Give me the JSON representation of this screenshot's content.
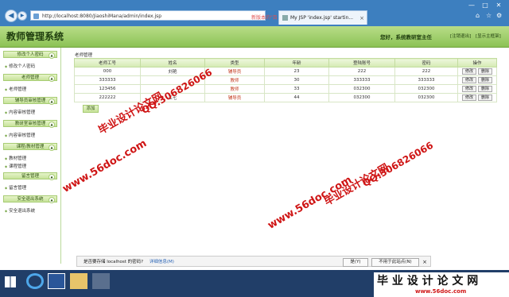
{
  "browser": {
    "url": "http://localhost:8080/JiaoshiMana/admin/index.jsp",
    "inactive_tab": "新版本的\"百度一下\"",
    "tab_title": "My JSP 'index.jsp' startin...",
    "win_controls": [
      "—",
      "□",
      "✕"
    ],
    "tool_icons": [
      "⌂",
      "☆",
      "⚙"
    ]
  },
  "header": {
    "title": "教师管理系统",
    "welcome": "您好，系统教研室主任",
    "logout": "[注销退出]",
    "home": "[显示主框架]"
  },
  "sidebar": {
    "sections": [
      {
        "title": "修改个人密码",
        "items": [
          "修改个人密码"
        ]
      },
      {
        "title": "老师管理",
        "items": [
          "老师管理"
        ]
      },
      {
        "title": "辅导员审核管理",
        "items": [
          "内容审核管理"
        ]
      },
      {
        "title": "教研室审核管理",
        "items": [
          "内容审核管理"
        ]
      },
      {
        "title": "课程/教材管理",
        "items": [
          "教材管理",
          "课程管理"
        ]
      },
      {
        "title": "留言管理",
        "items": [
          "留言管理"
        ]
      },
      {
        "title": "安全退出系统",
        "items": [
          "安全退出系统"
        ]
      }
    ]
  },
  "main": {
    "title": "老师管理",
    "columns": [
      "老师工号",
      "姓名",
      "类型",
      "年龄",
      "登陆账号",
      "密码",
      "操作"
    ],
    "rows": [
      {
        "id": "000",
        "name": "刘艳",
        "type": "辅导员",
        "age": "23",
        "account": "222",
        "password": "222"
      },
      {
        "id": "333333",
        "name": "",
        "type": "教师",
        "age": "30",
        "account": "333333",
        "password": "333333"
      },
      {
        "id": "123456",
        "name": "",
        "type": "教师",
        "age": "33",
        "account": "032300",
        "password": "032300"
      },
      {
        "id": "222222",
        "name": "江七",
        "type": "辅导员",
        "age": "44",
        "account": "032300",
        "password": "032300"
      }
    ],
    "edit_label": "修改",
    "delete_label": "删除",
    "add_label": "添加"
  },
  "password_bar": {
    "question": "是否要存储 localhost 的密码?",
    "detail": "详细信息(M)",
    "yes": "是(Y)",
    "no": "不用于此站点(N)"
  },
  "watermarks": {
    "site": "www.56doc.com",
    "title": "毕业设计论文网",
    "qq": "QQ:306826066",
    "logo_title": "毕 业 设 计 论 文 网",
    "logo_site": "www.56doc.com"
  },
  "colors": {
    "header_green": "#8cc255",
    "chrome_blue": "#3d7fbf",
    "watermark_red": "#cf1515"
  }
}
